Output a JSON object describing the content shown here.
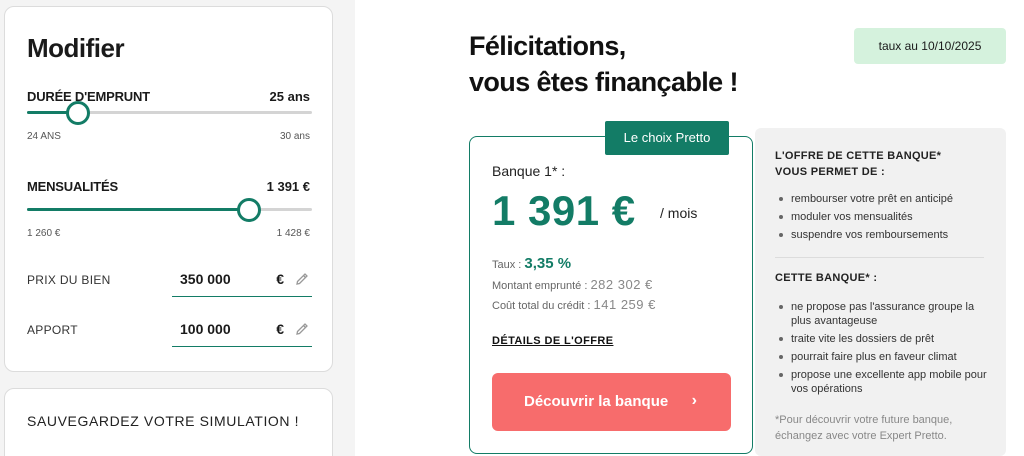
{
  "edit_panel": {
    "title": "Modifier",
    "duration": {
      "label": "DURÉE D'EMPRUNT",
      "value": "25 ans",
      "min_label": "24 ANS",
      "max_label": "30 ans",
      "fraction": 0.18
    },
    "monthly": {
      "label": "MENSUALITÉS",
      "value": "1 391 €",
      "min_label": "1 260 €",
      "max_label": "1 428 €",
      "fraction": 0.78
    },
    "price": {
      "label": "PRIX DU BIEN",
      "value": "350 000",
      "unit": "€"
    },
    "deposit": {
      "label": "APPORT",
      "value": "100 000",
      "unit": "€"
    }
  },
  "save_panel": {
    "title": "SAUVEGARDEZ VOTRE SIMULATION !"
  },
  "main": {
    "headline_line1": "Félicitations,",
    "headline_line2": "vous êtes finançable !",
    "rate_badge": "taux au 10/10/2025"
  },
  "offer": {
    "tag": "Le choix Pretto",
    "bank": "Banque 1* :",
    "amount": "1 391 €",
    "per_month": "/ mois",
    "rate_label": "Taux :",
    "rate_value": "3,35 %",
    "borrowed_label": "Montant emprunté :",
    "borrowed_value": "282 302 €",
    "total_cost_label": "Coût total du crédit :",
    "total_cost_value": "141 259 €",
    "details_link": "DÉTAILS DE L'OFFRE",
    "cta_label": "Découvrir la banque",
    "cta_arrow": "›"
  },
  "info": {
    "heading1": "L'OFFRE DE CETTE BANQUE* VOUS PERMET DE :",
    "list1": [
      "rembourser votre prêt en anticipé",
      "moduler vos mensualités",
      "suspendre vos remboursements"
    ],
    "heading2": "CETTE BANQUE* :",
    "list2": [
      "ne propose pas l'assurance groupe la plus avantageuse",
      "traite vite les dossiers de prêt",
      "pourrait faire plus en faveur climat",
      "propose une excellente app mobile pour vos opérations"
    ],
    "footnote": "*Pour découvrir votre future banque, échangez avec votre Expert Pretto."
  },
  "colors": {
    "accent": "#137c66",
    "cta": "#f76c6c",
    "badge": "#d5f2dd"
  },
  "icons": {
    "edit": "pencil-icon",
    "arrow": "chevron-right-icon"
  }
}
